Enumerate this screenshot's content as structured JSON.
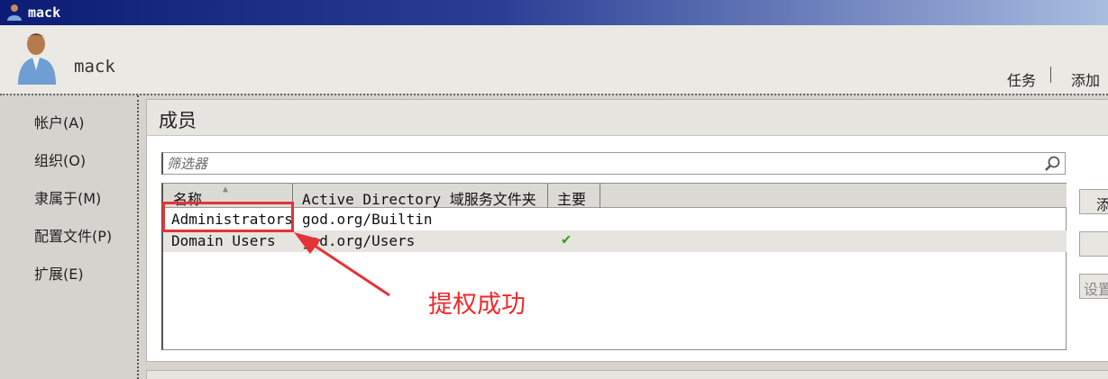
{
  "window": {
    "title": "mack",
    "icon": "user-icon"
  },
  "header": {
    "user_name": "mack",
    "task_link": "任务",
    "add_link": "添加",
    "avatar_icon": "user-avatar-icon"
  },
  "nav": {
    "items": [
      {
        "label": "帐户(A)"
      },
      {
        "label": "组织(O)"
      },
      {
        "label": "隶属于(M)"
      },
      {
        "label": "配置文件(P)"
      },
      {
        "label": "扩展(E)"
      }
    ]
  },
  "members": {
    "title": "成员",
    "filter_placeholder": "筛选器",
    "columns": [
      "名称",
      "Active Directory 域服务文件夹",
      "主要"
    ],
    "sort": "ascending",
    "rows": [
      {
        "name": "Administrators",
        "folder": "god.org/Builtin",
        "primary": false
      },
      {
        "name": "Domain Users",
        "folder": "god.org/Users",
        "primary": true
      }
    ],
    "buttons": {
      "add": "添",
      "settings": "设置"
    }
  },
  "annotation": {
    "text": "提权成功",
    "color": "#e53238"
  },
  "colors": {
    "titlebar": "#0c1c74",
    "accent_red": "#e53238",
    "check_green": "#2ea31f"
  }
}
